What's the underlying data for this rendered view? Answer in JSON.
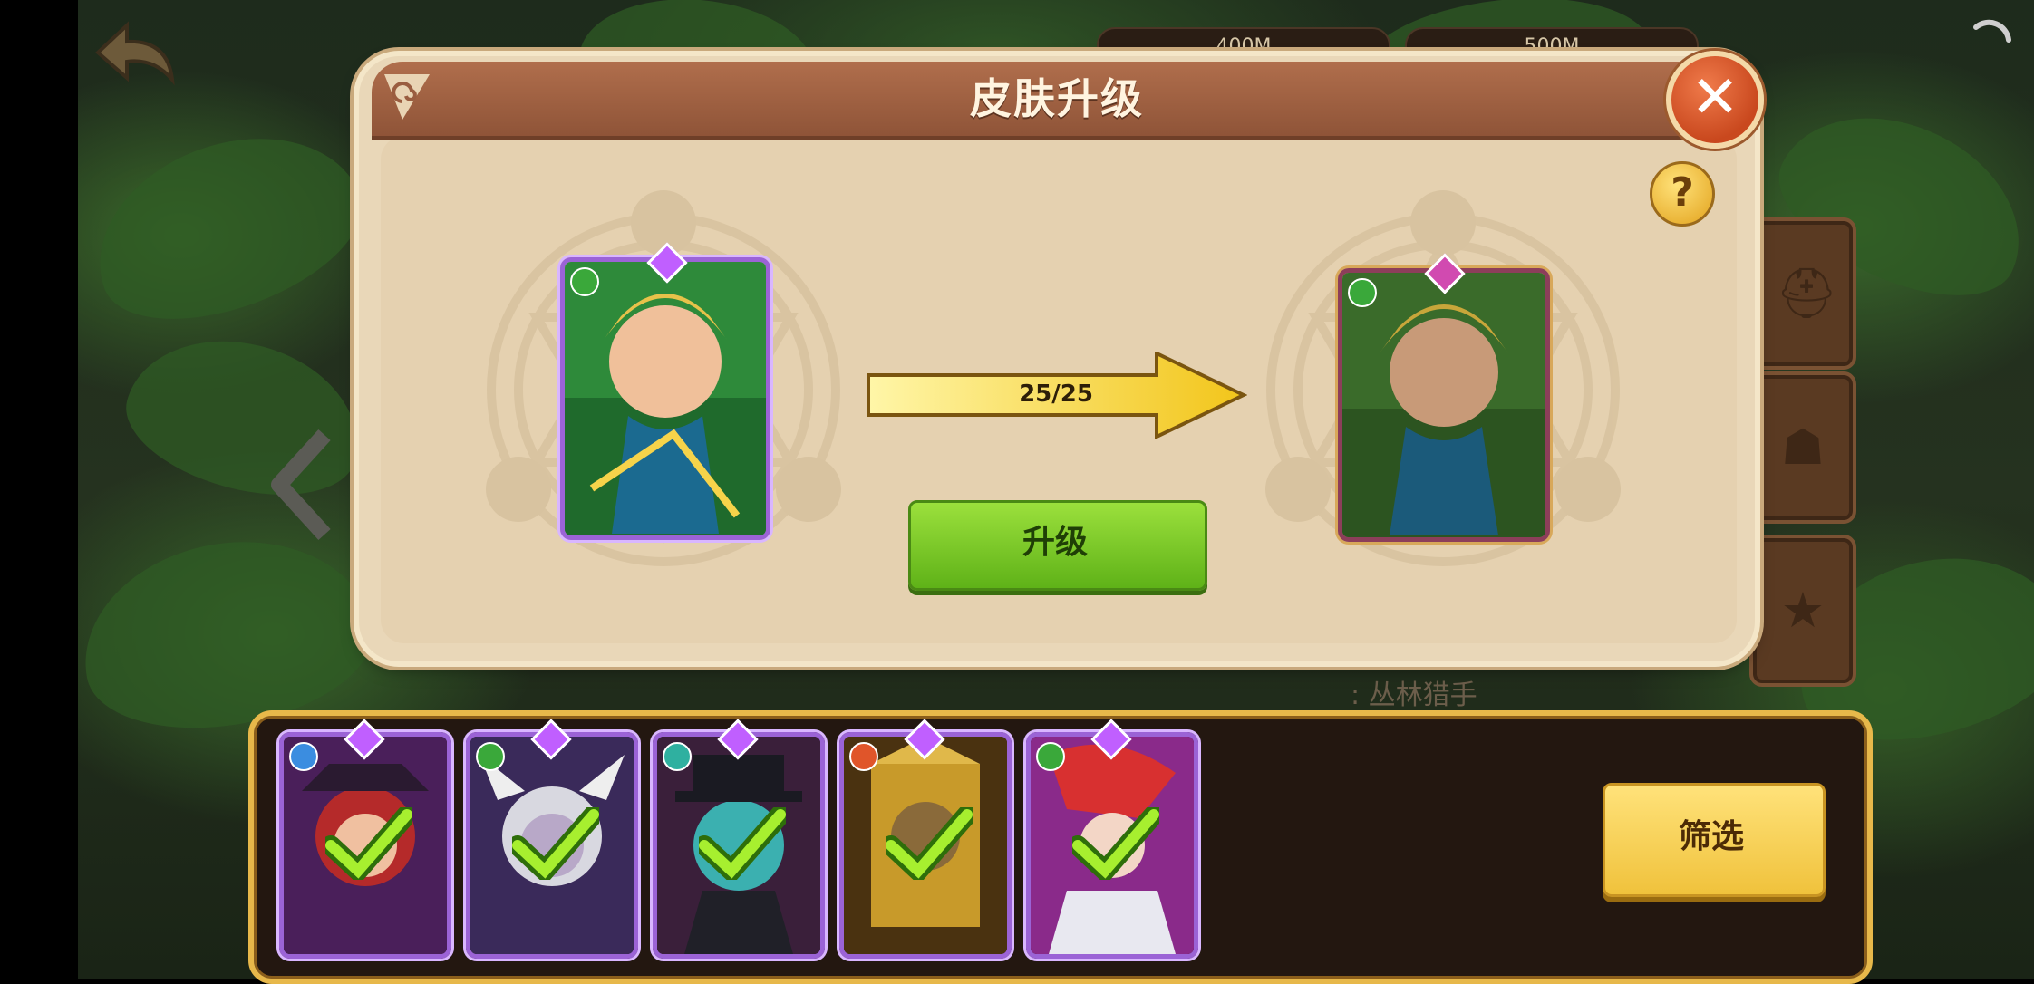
{
  "dialog": {
    "title": "皮肤升级",
    "progress": "25/25",
    "upgrade_label": "升级"
  },
  "background": {
    "class_label": ": 丛林猎手",
    "resource_left": "400M",
    "resource_right": "500M"
  },
  "bottom": {
    "filter_label": "筛选",
    "material_slots": [
      {
        "element": "water",
        "selected": true
      },
      {
        "element": "forest",
        "selected": true
      },
      {
        "element": "undead",
        "selected": true
      },
      {
        "element": "fire",
        "selected": true
      },
      {
        "element": "forest",
        "selected": true
      }
    ]
  },
  "colors": {
    "title_bar": "#9a5d40",
    "upgrade_button": "#7cc82a",
    "filter_button": "#f5cd4e",
    "close_button": "#d9552a",
    "card_border": "#9b63d6"
  },
  "icons": [
    "back-arrow-icon",
    "loading-icon",
    "swirl-icon",
    "close-icon",
    "help-icon",
    "right-arrow-icon",
    "checkmark-icon"
  ]
}
